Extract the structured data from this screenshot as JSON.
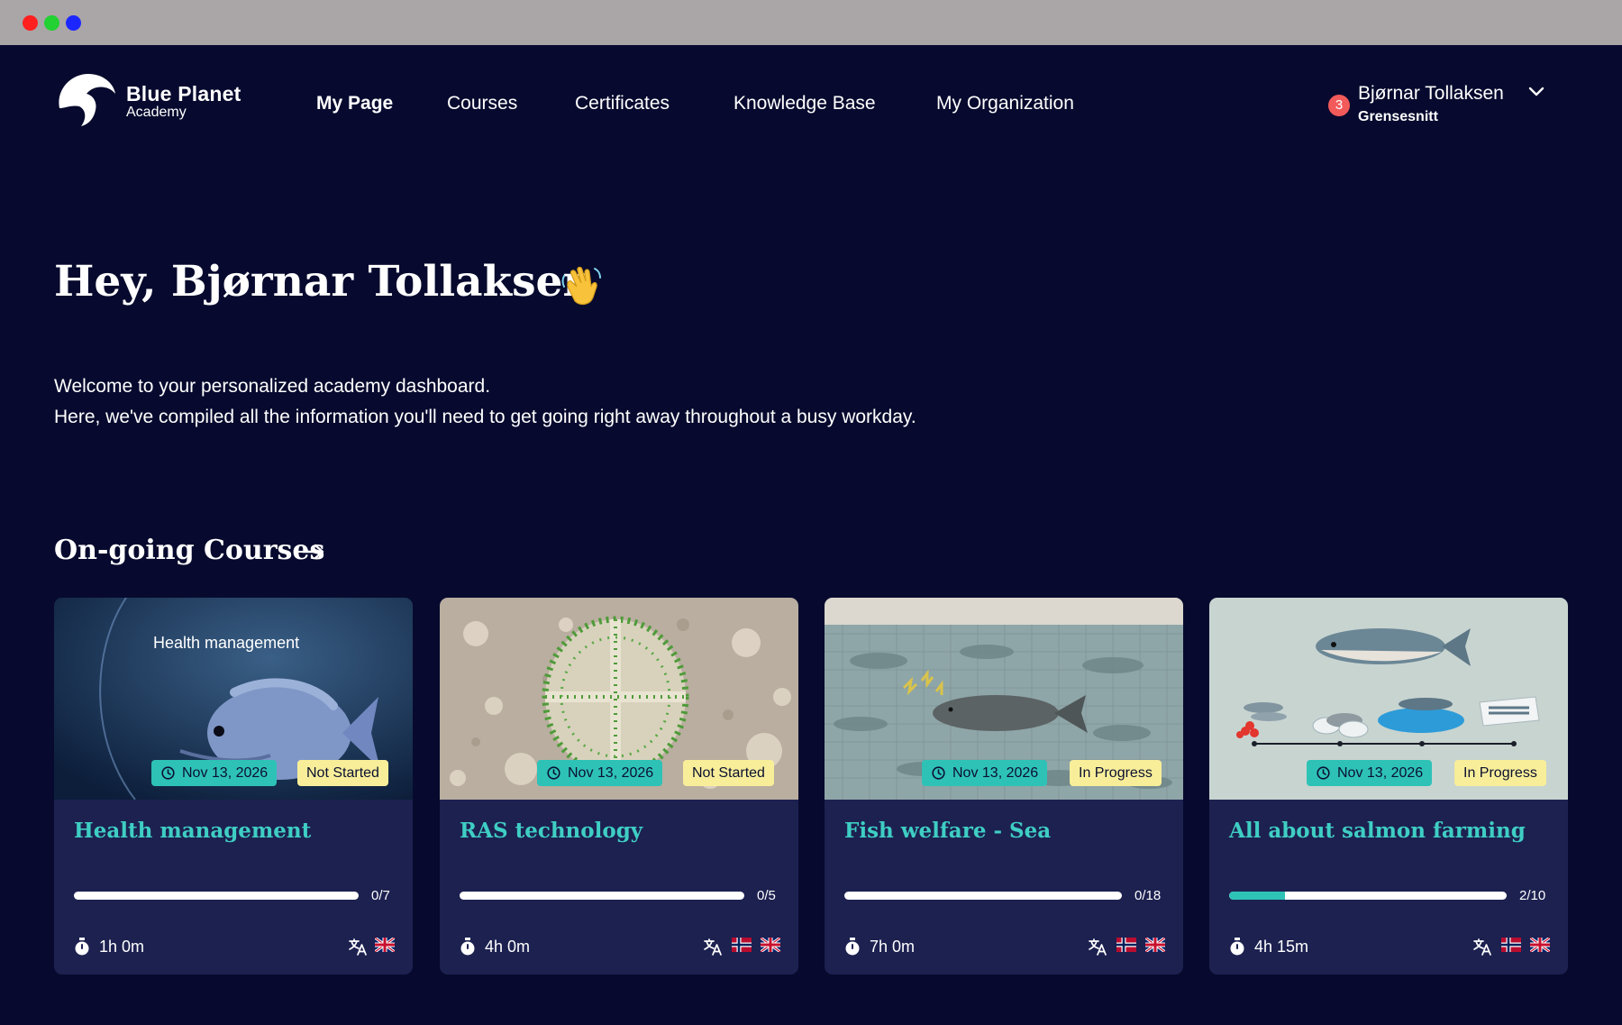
{
  "logo": {
    "title": "Blue Planet",
    "subtitle": "Academy"
  },
  "nav": [
    {
      "label": "My Page",
      "active": true
    },
    {
      "label": "Courses",
      "active": false
    },
    {
      "label": "Certificates",
      "active": false
    },
    {
      "label": "Knowledge Base",
      "active": false
    },
    {
      "label": "My Organization",
      "active": false
    }
  ],
  "user": {
    "notifications": "3",
    "name": "Bjørnar Tollaksen",
    "organization": "Grensesnitt"
  },
  "hero": {
    "greeting": "Hey, Bjørnar Tollaksen",
    "welcome_line1": "Welcome to your personalized academy dashboard.",
    "welcome_line2": "Here, we've compiled all the information you'll need to get going right away throughout a busy workday."
  },
  "ongoing": {
    "title": "On-going Courses"
  },
  "courses": [
    {
      "title": "Health management",
      "image_caption": "Health management",
      "date": "Nov 13, 2026",
      "status": "Not Started",
      "progress_label": "0/7",
      "progress": 0,
      "duration": "1h 0m",
      "languages": [
        "en"
      ]
    },
    {
      "title": "RAS technology",
      "date": "Nov 13, 2026",
      "status": "Not Started",
      "progress_label": "0/5",
      "progress": 0,
      "duration": "4h 0m",
      "languages": [
        "no",
        "en"
      ]
    },
    {
      "title": "Fish welfare - Sea",
      "date": "Nov 13, 2026",
      "status": "In Progress",
      "progress_label": "0/18",
      "progress": 0,
      "duration": "7h 0m",
      "languages": [
        "no",
        "en"
      ]
    },
    {
      "title": "All about salmon farming",
      "date": "Nov 13, 2026",
      "status": "In Progress",
      "progress_label": "2/10",
      "progress": 0.2,
      "duration": "4h 15m",
      "languages": [
        "no",
        "en"
      ]
    }
  ],
  "colors": {
    "background": "#070a2e",
    "card": "#1c2150",
    "accent": "#2ec2b7",
    "status": "#f8ee9a",
    "badge": "#f35a5a"
  }
}
